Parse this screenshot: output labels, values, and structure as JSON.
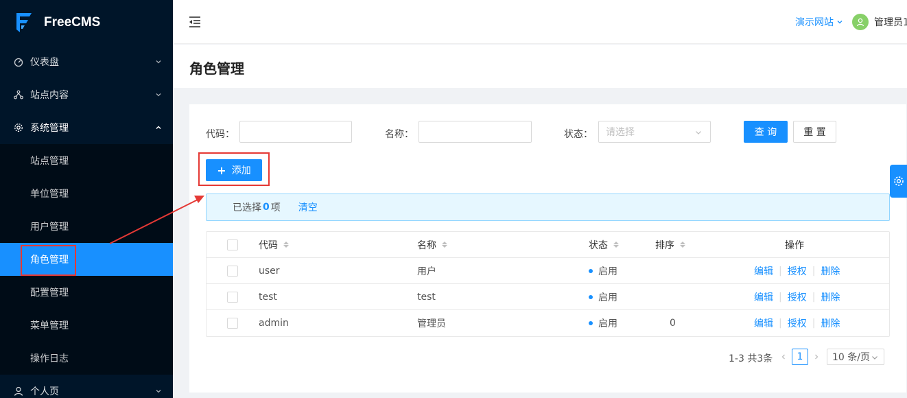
{
  "brand": {
    "name": "FreeCMS",
    "color": "#1890ff"
  },
  "sidebar": {
    "items": [
      {
        "label": "仪表盘",
        "icon": "dashboard-icon"
      },
      {
        "label": "站点内容",
        "icon": "content-tree-icon"
      },
      {
        "label": "系统管理",
        "icon": "gear-icon"
      }
    ],
    "submenu": [
      {
        "label": "站点管理"
      },
      {
        "label": "单位管理"
      },
      {
        "label": "用户管理"
      },
      {
        "label": "角色管理"
      },
      {
        "label": "配置管理"
      },
      {
        "label": "菜单管理"
      },
      {
        "label": "操作日志"
      }
    ],
    "last_item": {
      "label": "个人页",
      "icon": "user-icon"
    },
    "active_submenu": "角色管理"
  },
  "header": {
    "site_switch": "演示网站",
    "user_name": "管理员1"
  },
  "page": {
    "title": "角色管理"
  },
  "filters": {
    "code_label": "代码：",
    "name_label": "名称：",
    "status_label": "状态：",
    "status_placeholder": "请选择",
    "query_button": "查 询",
    "reset_button": "重 置"
  },
  "add_button": "添加",
  "selection": {
    "prefix": "已选择",
    "count": "0",
    "suffix": "项",
    "clear": "清空"
  },
  "table": {
    "columns": [
      "代码",
      "名称",
      "状态",
      "排序",
      "操作"
    ],
    "rows": [
      {
        "code": "user",
        "name": "用户",
        "status": "启用",
        "order": ""
      },
      {
        "code": "test",
        "name": "test",
        "status": "启用",
        "order": ""
      },
      {
        "code": "admin",
        "name": "管理员",
        "status": "启用",
        "order": "0"
      }
    ],
    "actions": {
      "edit": "编辑",
      "grant": "授权",
      "delete": "删除"
    }
  },
  "pagination": {
    "total": "1-3 共3条",
    "current_page": "1",
    "page_size": "10 条/页"
  },
  "annotation_color": "#e53935"
}
